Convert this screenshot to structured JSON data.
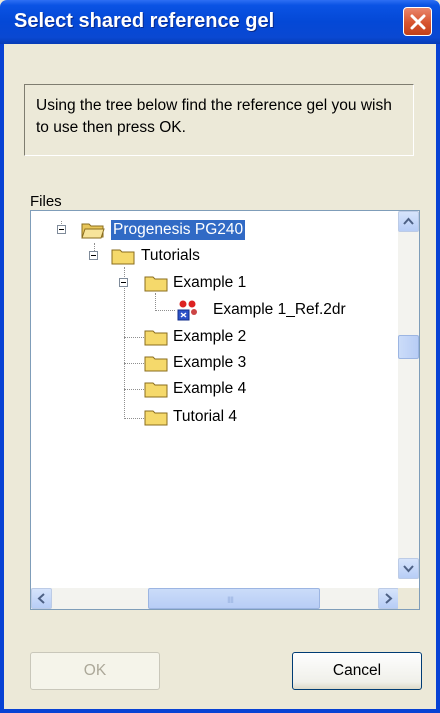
{
  "window": {
    "title": "Select shared reference gel"
  },
  "instructions": "Using the tree below find the reference gel you wish to use then press OK.",
  "files_label": "Files",
  "tree": {
    "root": "Progenesis PG240",
    "tutorials": "Tutorials",
    "example1": "Example 1",
    "example1_file": "Example 1_Ref.2dr",
    "example2": "Example 2",
    "example3": "Example 3",
    "example4": "Example 4",
    "tutorial4": "Tutorial 4"
  },
  "scroll": {
    "h_grip": "IIII"
  },
  "buttons": {
    "ok": "OK",
    "cancel": "Cancel"
  },
  "colors": {
    "titlebar": "#0448d6",
    "selection": "#316ac5",
    "close": "#d7542f",
    "folder": "#f5d96b"
  }
}
